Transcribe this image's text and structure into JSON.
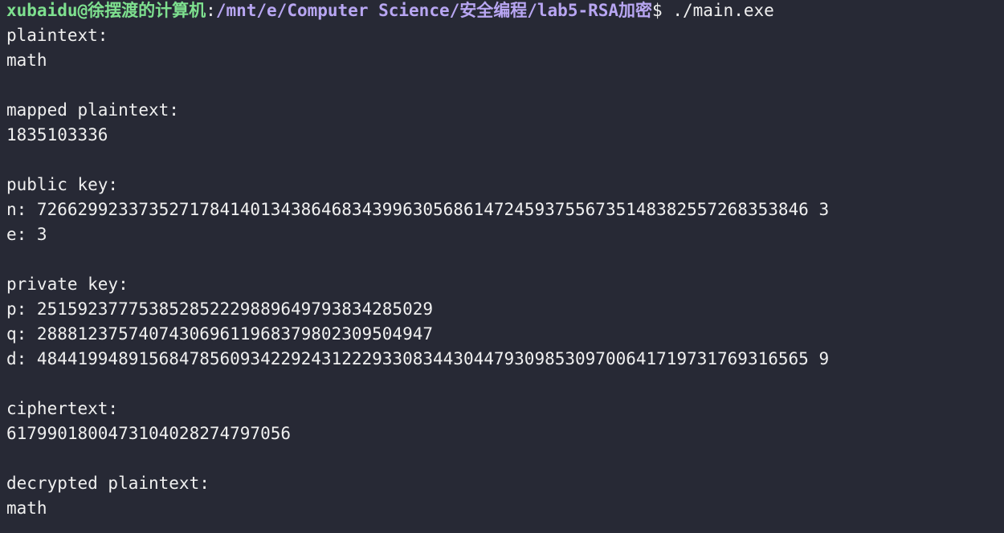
{
  "colors": {
    "background": "#272935",
    "text": "#f0f0f0",
    "prompt_user": "#7ee08f",
    "prompt_path": "#b8a6f2"
  },
  "prompt": {
    "user_host": "xubaidu@徐摆渡的计算机",
    "colon": ":",
    "path": "/mnt/e/Computer Science/安全编程/lab5-RSA加密",
    "symbol": "$ ",
    "command": "./main.exe"
  },
  "output": {
    "plaintext_label": "plaintext:",
    "plaintext_value": "math",
    "mapped_label": "mapped plaintext:",
    "mapped_value": "1835103336",
    "public_key_label": "public key:",
    "n_line": "n: 7266299233735271784140134386468343996305686147245937556735148382557268353846 3",
    "e_line": "e: 3",
    "private_key_label": "private key:",
    "p_line": "p: 251592377753852852229889649793834285029",
    "q_line": "q: 288812375740743069611968379802309504947",
    "d_line": "d: 4844199489156847856093422924312229330834430447930985309700641719731769316565 9",
    "ciphertext_label": "ciphertext:",
    "ciphertext_value": "6179901800473104028274797056",
    "decrypted_label": "decrypted plaintext:",
    "decrypted_value": "math"
  }
}
